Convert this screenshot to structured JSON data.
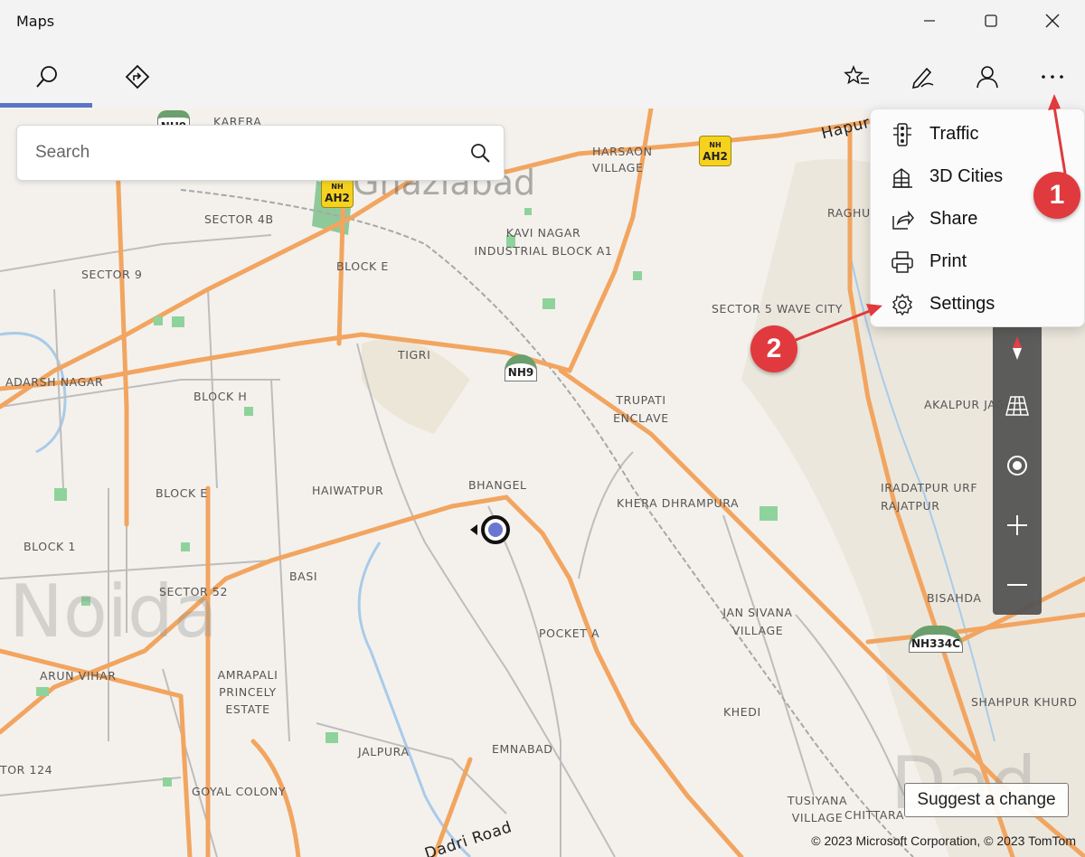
{
  "app": {
    "title": "Maps"
  },
  "toolbar": {
    "map_style": "Road"
  },
  "search": {
    "placeholder": "Search"
  },
  "menu": {
    "items": [
      {
        "label": "Traffic",
        "icon": "traffic-light-icon"
      },
      {
        "label": "3D Cities",
        "icon": "3d-cities-icon"
      },
      {
        "label": "Share",
        "icon": "share-icon"
      },
      {
        "label": "Print",
        "icon": "print-icon"
      },
      {
        "label": "Settings",
        "icon": "gear-icon"
      }
    ]
  },
  "annotations": {
    "badge1": "1",
    "badge2": "2",
    "color": "#e03a3e"
  },
  "map": {
    "places": [
      "KARERA",
      "HARSAON VILLAGE",
      "SECTOR 4B",
      "SECTOR 9",
      "BLOCK E",
      "KAVI NAGAR INDUSTRIAL BLOCK A1",
      "RAGHU",
      "SECTOR 5 WAVE CITY",
      "TIGRI",
      "ADARSH NAGAR",
      "BLOCK H",
      "TRUPATI ENCLAVE",
      "AKALPUR JAGIR",
      "BHANGEL",
      "HAIWATPUR",
      "KHERA DHRAMPURA",
      "IRADATPUR URF RAJATPUR",
      "BLOCK E",
      "BLOCK 1",
      "BASI",
      "SECTOR 52",
      "BISAHDA",
      "JAN SIVANA VILLAGE",
      "POCKET A",
      "ARUN VIHAR",
      "AMRAPALI PRINCELY ESTATE",
      "SHAHPUR KHURD",
      "KHEDI",
      "JALPURA",
      "EMNABAD",
      "TOR 124",
      "GOYAL COLONY",
      "TUSIYANA VILLAGE",
      "CHITTARA"
    ],
    "road_labels": [
      "Hapur",
      "Dadri Road"
    ],
    "city_labels": [
      "Ghaziabad",
      "Noida",
      "Dad"
    ],
    "shields": [
      "NH9",
      "NH9",
      "AH2",
      "AH2",
      "NH334C"
    ]
  },
  "suggest_label": "Suggest a change",
  "copyright": "© 2023 Microsoft Corporation, © 2023 TomTom"
}
